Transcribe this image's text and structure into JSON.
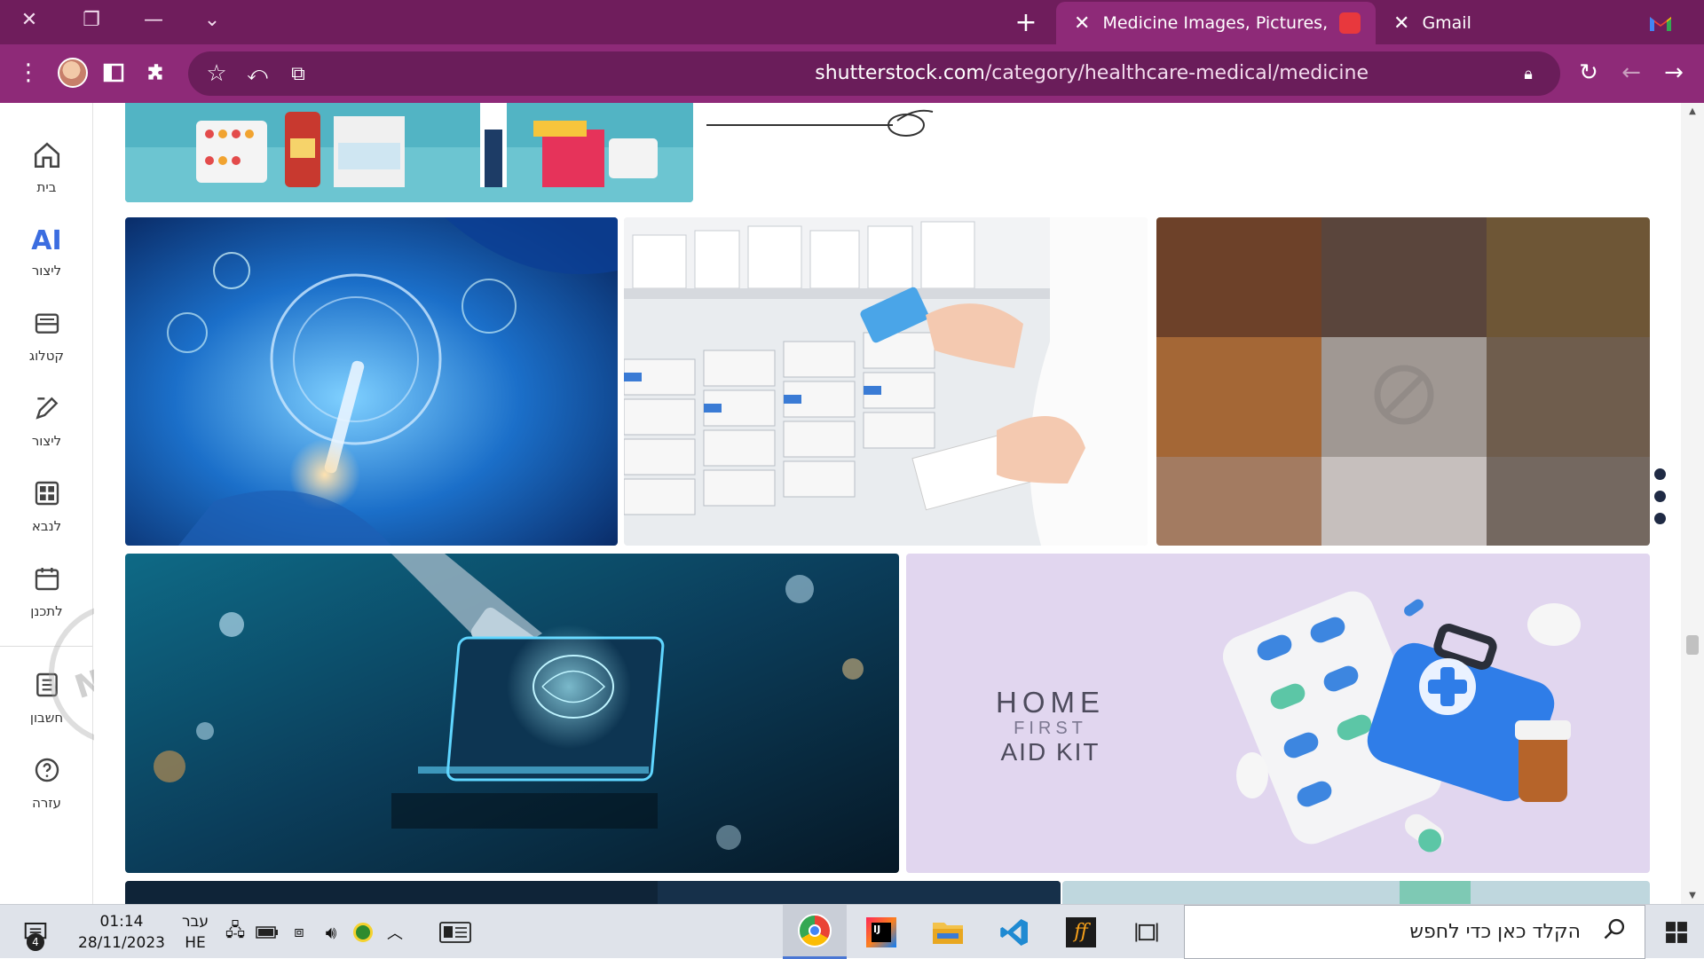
{
  "browser": {
    "tabs": [
      {
        "title": "Medicine Images, Pictures, Photo",
        "active": true
      },
      {
        "title": "Gmail",
        "active": false
      }
    ],
    "url_host": "shutterstock.com",
    "url_path": "/category/healthcare-medical/medicine"
  },
  "rail": {
    "items": [
      {
        "icon": "home-icon",
        "label": "בית"
      },
      {
        "icon": "ai-icon",
        "label": "ליצור",
        "glyph": "AI"
      },
      {
        "icon": "catalog-icon",
        "label": "קטלוג"
      },
      {
        "icon": "edit-icon",
        "label": "ליצור"
      },
      {
        "icon": "grid-icon",
        "label": "לנבא"
      },
      {
        "icon": "calendar-icon",
        "label": "לתכנן"
      },
      {
        "icon": "account-icon",
        "label": "חשבון"
      },
      {
        "icon": "help-icon",
        "label": "עזרה"
      }
    ]
  },
  "content": {
    "aid_kit_title": "HOME",
    "aid_kit_sub1": "FIRST",
    "aid_kit_sub2": "AID KIT"
  },
  "taskbar": {
    "notif_count": "4",
    "time": "01:14",
    "date": "28/11/2023",
    "lang_top": "עבר",
    "lang_bottom": "HE",
    "search_placeholder": "הקלד כאן כדי לחפש"
  },
  "colors": {
    "titlebar": "#6f1d5c",
    "toolbar": "#8e2a78",
    "omnibox": "#6a1d5a",
    "accent": "#4a77d4"
  }
}
